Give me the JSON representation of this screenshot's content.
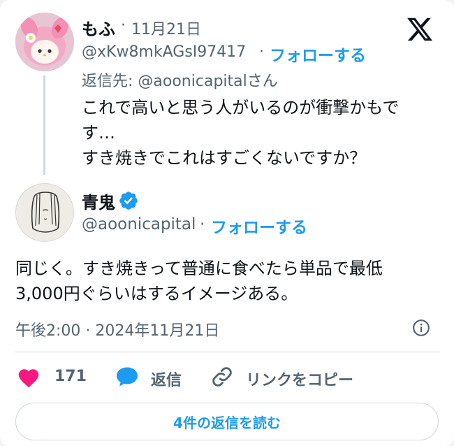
{
  "reply_tweet": {
    "display_name": "もふ",
    "separator": "·",
    "date": "11月21日",
    "handle": "@xKw8mkAGsI97417",
    "handle_separator": "·",
    "follow_label": "フォローする",
    "reply_to": "返信先: @aoonicapitalさん",
    "body_lines": [
      "これで高いと思う人がいるのが衝撃かもで",
      "す…",
      "すき焼きでこれはすごくないですか？"
    ]
  },
  "main_tweet": {
    "display_name": "青鬼",
    "handle": "@aoonicapital",
    "handle_separator": "·",
    "follow_label": "フォローする",
    "body_lines": [
      "同じく。すき焼きって普通に食べたら単品で最低",
      "3,000円ぐらいはするイメージある。"
    ],
    "timestamp": "午後2:00 · 2024年11月21日"
  },
  "actions": {
    "likes_count": "171",
    "reply_label": "返信",
    "copy_link_label": "リンクをコピー"
  },
  "read_replies_label": "4件の返信を読む",
  "icons": {
    "brand": "x-logo-icon",
    "verified": "verified-badge-icon",
    "info": "info-icon",
    "like": "heart-icon",
    "reply": "speech-bubble-icon",
    "link": "link-icon"
  },
  "colors": {
    "accent": "#1d9bf0",
    "like": "#f91880",
    "text_secondary": "#536471"
  }
}
